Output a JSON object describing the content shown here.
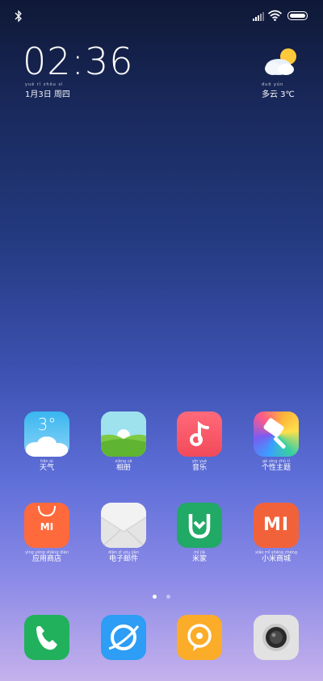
{
  "status": {
    "bluetooth": "bluetooth-icon",
    "signal": "signal-icon",
    "wifi": "wifi-icon",
    "battery": "battery-icon"
  },
  "lockinfo": {
    "time": "02:36",
    "date_pinyin": "yuè rì  zhōu sì",
    "date": "1月3日 周四",
    "weather_pinyin": "duō yún",
    "weather": "多云 3℃",
    "weather_icon": "partly-cloudy-icon"
  },
  "apps": [
    {
      "pinyin": "tiān qì",
      "label": "天气",
      "icon": "weather-app-icon",
      "temp": "3°"
    },
    {
      "pinyin": "xiàng cè",
      "label": "相册",
      "icon": "gallery-app-icon"
    },
    {
      "pinyin": "yīn yuè",
      "label": "音乐",
      "icon": "music-app-icon"
    },
    {
      "pinyin": "gè xìng zhǔ tí",
      "label": "个性主题",
      "icon": "themes-app-icon"
    },
    {
      "pinyin": "yìng yòng shāng diàn",
      "label": "应用商店",
      "icon": "app-store-icon",
      "mark": "MI"
    },
    {
      "pinyin": "diàn zǐ yóu jiàn",
      "label": "电子邮件",
      "icon": "email-app-icon"
    },
    {
      "pinyin": "mǐ jiā",
      "label": "米家",
      "icon": "mijia-app-icon"
    },
    {
      "pinyin": "xiǎo mǐ shāng chéng",
      "label": "小米商城",
      "icon": "mi-store-app-icon",
      "mark": "MI"
    }
  ],
  "dock": [
    {
      "icon": "phone-app-icon"
    },
    {
      "icon": "browser-app-icon"
    },
    {
      "icon": "messaging-app-icon"
    },
    {
      "icon": "camera-app-icon"
    }
  ],
  "pages": {
    "count": 2,
    "current": 1
  }
}
